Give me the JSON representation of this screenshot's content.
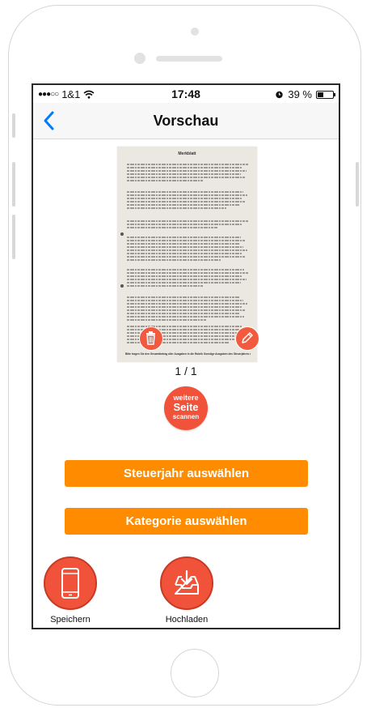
{
  "status_bar": {
    "carrier": "1&1",
    "time": "17:48",
    "battery": "39 %",
    "battery_level": 0.39
  },
  "nav": {
    "title": "Vorschau",
    "back_icon": "chevron-left-icon"
  },
  "preview": {
    "document_title": "Merkblatt",
    "page_indicator": "1 / 1",
    "delete_icon": "trash-icon",
    "edit_icon": "pencil-icon",
    "footer_text": "Bitte tragen Sie den Gesamtbetrag aller Ausgaben in die Rubrik Sonstige Ausgaben des Steuerjahres ein."
  },
  "scan_more": {
    "line1": "weitere",
    "line2": "Seite",
    "line3": "scannen"
  },
  "buttons": {
    "tax_year": "Steuerjahr auswählen",
    "category": "Kategorie auswählen"
  },
  "actions": {
    "save_label": "Speichern",
    "save_icon": "smartphone-icon",
    "upload_label": "Hochladen",
    "upload_icon": "inbox-download-icon"
  },
  "colors": {
    "accent_orange": "#ff8c00",
    "accent_red": "#f0523a",
    "ios_blue": "#007aff"
  }
}
